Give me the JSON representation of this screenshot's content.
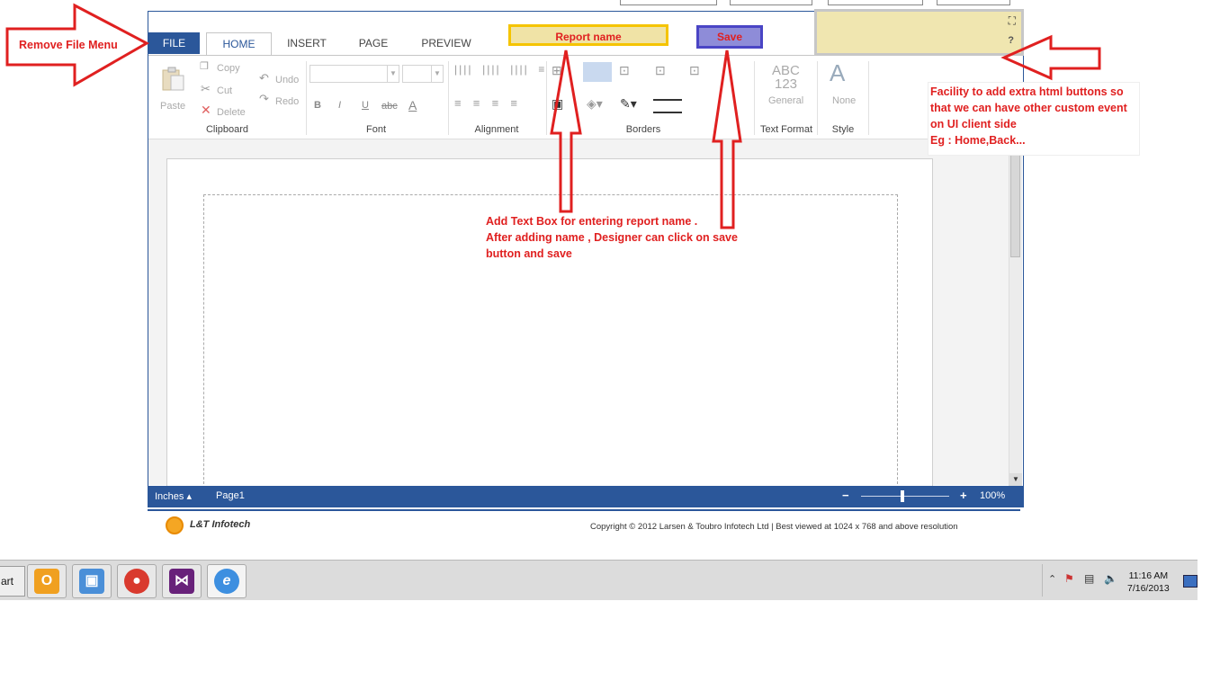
{
  "ribbon": {
    "tabs": {
      "file": "FILE",
      "home": "HOME",
      "insert": "INSERT",
      "page": "PAGE",
      "preview": "PREVIEW"
    },
    "clipboard": {
      "paste": "Paste",
      "copy": "Copy",
      "cut": "Cut",
      "delete": "Delete",
      "label": "Clipboard"
    },
    "undo_redo": {
      "undo": "Undo",
      "redo": "Redo"
    },
    "font": {
      "bold": "B",
      "italic": "I",
      "underline": "U",
      "strike": "abc",
      "color": "A",
      "label": "Font"
    },
    "alignment": {
      "label": "Alignment"
    },
    "borders": {
      "label": "Borders"
    },
    "text_format": {
      "sample_top": "ABC",
      "sample_bottom": "123",
      "value": "General",
      "label": "Text Format"
    },
    "style": {
      "sample": "A",
      "value": "None",
      "label": "Style"
    }
  },
  "custom": {
    "report_name": "Report name",
    "save": "Save",
    "help": "?"
  },
  "status": {
    "units": "Inches ▴",
    "page": "Page1",
    "zoom_minus": "−",
    "zoom_plus": "+",
    "zoom": "100%"
  },
  "footer": {
    "company": "L&T Infotech",
    "copyright": "Copyright © 2012 Larsen & Toubro Infotech Ltd | Best viewed at 1024 x 768 and above resolution"
  },
  "annotations": {
    "remove_file": "Remove File Menu",
    "textbox_line1": "Add Text Box for entering report name .",
    "textbox_line2": "After adding name , Designer can click on save",
    "textbox_line3": "button and save",
    "facility_line1": "Facility to add extra html buttons so",
    "facility_line2": "that we can have other custom event",
    "facility_line3": "on UI client side",
    "facility_line4": "Eg : Home,Back..."
  },
  "taskbar": {
    "start": "art",
    "time": "11:16 AM",
    "date": "7/16/2013"
  },
  "colors": {
    "accent": "#2b579a",
    "annotation": "#e02020",
    "report_box": "#f0e3a6",
    "save_box": "#8e8cd8"
  }
}
